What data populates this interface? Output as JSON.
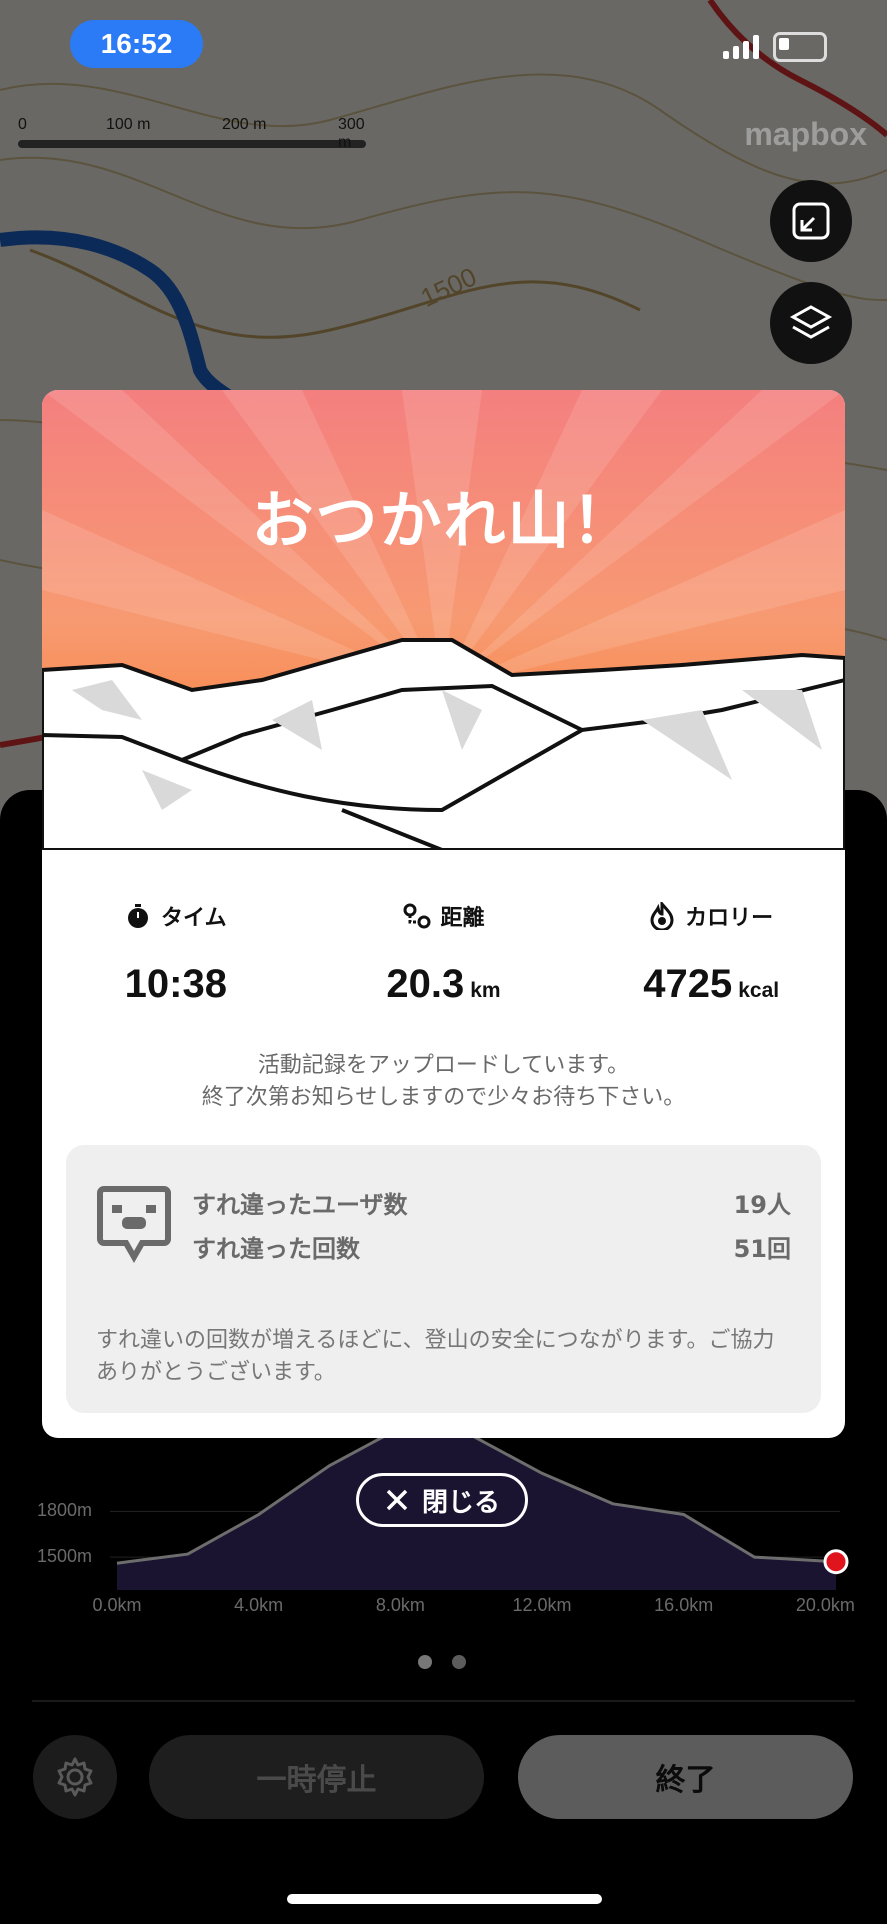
{
  "status_bar": {
    "time": "16:52"
  },
  "map": {
    "scale_labels": [
      "0",
      "100 m",
      "200 m",
      "300 m"
    ],
    "attribution": "mapbox",
    "contour_label": "1500",
    "buttons": [
      {
        "icon": "fit-bounds-icon"
      },
      {
        "icon": "layers-icon"
      }
    ]
  },
  "modal": {
    "title": "おつかれ山！",
    "stats": [
      {
        "icon": "stopwatch-icon",
        "label": "タイム",
        "value": "10:38",
        "unit": ""
      },
      {
        "icon": "route-icon",
        "label": "距離",
        "value": "20.3",
        "unit": "km"
      },
      {
        "icon": "flame-icon",
        "label": "カロリー",
        "value": "4725",
        "unit": "kcal"
      }
    ],
    "message_line1": "活動記録をアップロードしています。",
    "message_line2": "終了次第お知らせしますので少々お待ち下さい。",
    "encounter": {
      "users_label": "すれ違ったユーザ数",
      "users_value": "19人",
      "count_label": "すれ違った回数",
      "count_value": "51回",
      "note": "すれ違いの回数が増えるほどに、登山の安全につながります。ご協力ありがとうございます。"
    }
  },
  "close_button": {
    "label": "閉じる"
  },
  "chart_data": {
    "type": "area",
    "x": [
      0,
      2,
      4,
      6,
      8,
      10,
      12,
      14,
      16,
      18,
      20.3
    ],
    "y": [
      1460,
      1520,
      1780,
      2100,
      2350,
      2300,
      2050,
      1850,
      1780,
      1500,
      1470
    ],
    "xlabel": "",
    "ylabel": "",
    "x_tick_labels": [
      "0.0km",
      "4.0km",
      "8.0km",
      "12.0km",
      "16.0km",
      "20.0km"
    ],
    "y_tick_labels": [
      "1800m",
      "1500m"
    ],
    "xlim": [
      0,
      20.3
    ],
    "grid": true
  },
  "bottom_bar": {
    "pause_label": "一時停止",
    "end_label": "終了"
  }
}
